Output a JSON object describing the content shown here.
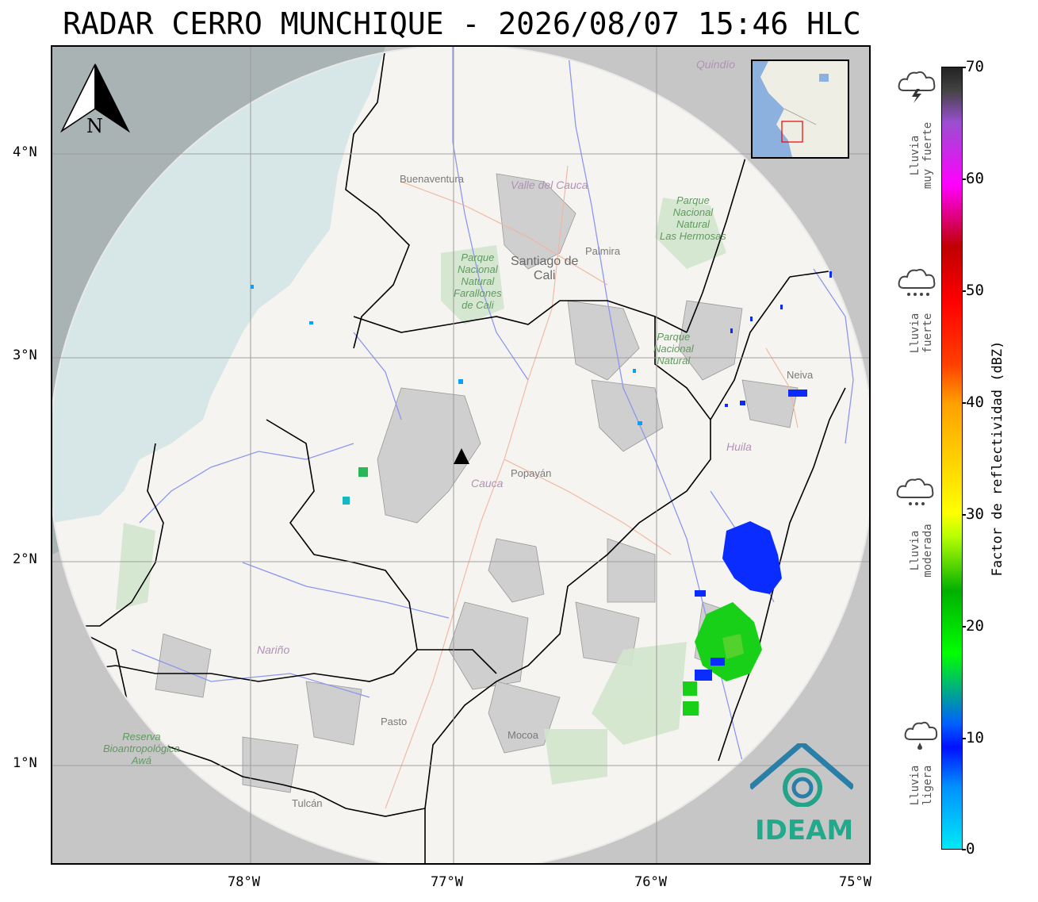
{
  "title": "RADAR CERRO MUNCHIQUE - 2026/08/07 15:46 HLC",
  "axes": {
    "longitude_ticks": [
      "78°W",
      "77°W",
      "76°W",
      "75°W"
    ],
    "latitude_ticks": [
      "4°N",
      "3°N",
      "2°N",
      "1°N"
    ]
  },
  "north_arrow": {
    "label": "N"
  },
  "colorbar": {
    "label": "Factor de reflectividad (dBZ)",
    "range": [
      0,
      70
    ],
    "ticks": [
      "70",
      "60",
      "50",
      "40",
      "30",
      "20",
      "10",
      "0"
    ],
    "stops": [
      "#00e9f5",
      "#0010ff",
      "#00ff00",
      "#ffff00",
      "#ff0000",
      "#ff00ff",
      "#222222"
    ]
  },
  "rain_categories": [
    {
      "line1": "Lluvia",
      "line2": "muy fuerte",
      "icon": "thunderstorm-icon"
    },
    {
      "line1": "Lluvia",
      "line2": "fuerte",
      "icon": "heavy-rain-icon"
    },
    {
      "line1": "Lluvia",
      "line2": "moderada",
      "icon": "moderate-rain-icon"
    },
    {
      "line1": "Lluvia",
      "line2": "ligera",
      "icon": "light-rain-icon"
    }
  ],
  "places": {
    "buenaventura": "Buenaventura",
    "valle": "Valle del Cauca",
    "quindio": "Quindío",
    "cali_line1": "Santiago de",
    "cali_line2": "Cali",
    "palmira": "Palmira",
    "farallones": [
      "Parque",
      "Nacional",
      "Natural",
      "Farallones",
      "de Cali"
    ],
    "hermosas": [
      "Parque",
      "Nacional",
      "Natural",
      "Las Hermosas"
    ],
    "parque_sur": [
      "Parque",
      "Nacional",
      "Natural",
      "..."
    ],
    "neiva": "Neiva",
    "huila": "Huila",
    "cauca": "Cauca",
    "popayan": "Popayán",
    "narino": "Nariño",
    "pasto": "Pasto",
    "mocoa": "Mocoa",
    "tulcan": "Tulcán",
    "awa": [
      "Reserva",
      "Bioantropológica",
      "Awá"
    ]
  },
  "radar_site": {
    "latitude": 2.5,
    "longitude": -76.96
  },
  "logo": {
    "text": "IDEAM",
    "color": "#22a88a"
  }
}
